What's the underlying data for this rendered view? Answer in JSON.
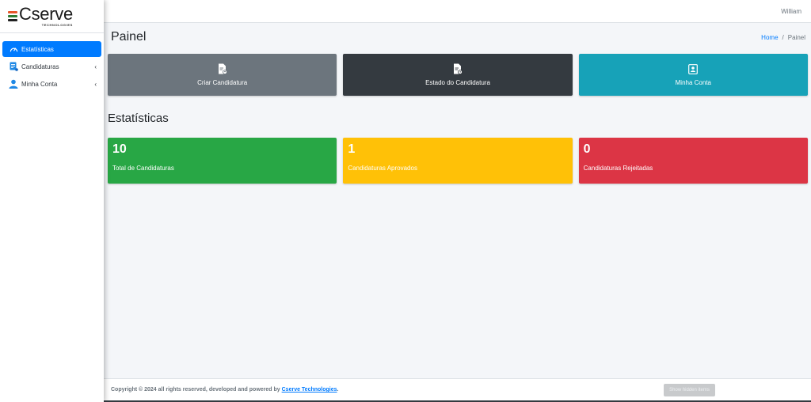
{
  "brand": {
    "name": "Cserve",
    "subtitle": "TECHNOLOGIES",
    "colors": [
      "#e8562a",
      "#2e7d32",
      "#212121"
    ]
  },
  "sidebar": {
    "items": [
      {
        "label": "Estatísticas",
        "icon": "dashboard-gauge-icon",
        "active": true
      },
      {
        "label": "Candidaturas",
        "icon": "document-list-icon",
        "chevron": "‹"
      },
      {
        "label": "Minha Conta",
        "icon": "user-icon",
        "chevron": "‹"
      }
    ]
  },
  "topbar": {
    "user": "William"
  },
  "header": {
    "title": "Painel",
    "breadcrumb": {
      "home": "Home",
      "separator": "/",
      "current": "Painel"
    }
  },
  "actions": [
    {
      "label": "Criar Candidatura",
      "icon": "file-edit-icon",
      "color": "#6c757d"
    },
    {
      "label": "Estado do Candidatura",
      "icon": "file-status-icon",
      "color": "#343a40"
    },
    {
      "label": "Minha Conta",
      "icon": "id-badge-icon",
      "color": "#17a2b8"
    }
  ],
  "section": {
    "title": "Estatísticas"
  },
  "stats": [
    {
      "value": "10",
      "label": "Total de Candidaturas",
      "color": "#28a745"
    },
    {
      "value": "1",
      "label": "Candidaturas Aprovados",
      "color": "#ffc107"
    },
    {
      "value": "0",
      "label": "Candidaturas Rejeitadas",
      "color": "#dc3545"
    }
  ],
  "footer": {
    "text": "Copyright © 2024 all rights reserved, developed and powered by",
    "link": "Cserve Technologies",
    "after": ".",
    "button": "Show hidden items"
  }
}
